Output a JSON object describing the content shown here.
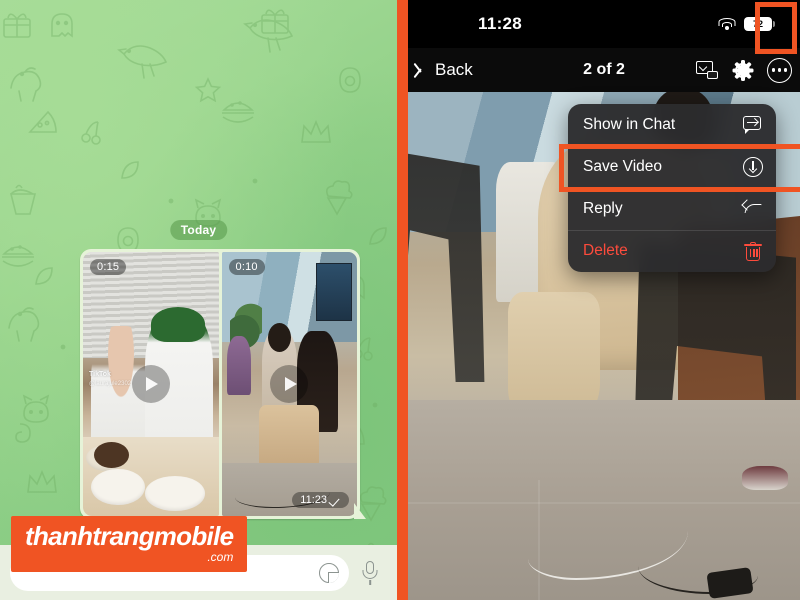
{
  "left_panel": {
    "date_chip": "Today",
    "message": {
      "timestamp": "11:23",
      "read_state_icon": "checkmark-icon",
      "videos": [
        {
          "duration": "0:15",
          "play_icon": "play-icon",
          "watermark_app": "TikTok",
          "watermark_user": "@laurajule2302"
        },
        {
          "duration": "0:10",
          "play_icon": "play-icon"
        }
      ]
    },
    "input_bar": {
      "placeholder": "",
      "value": "",
      "sticker_icon": "sticker-icon",
      "mic_icon": "microphone-icon"
    },
    "watermark": {
      "main": "thanhtrangmobile",
      "sub": ".com",
      "color": "#f05423"
    }
  },
  "right_panel": {
    "status_bar": {
      "time": "11:28",
      "wifi_icon": "wifi-icon",
      "battery_level": "72",
      "battery_icon": "battery-icon"
    },
    "nav_bar": {
      "back_label": "Back",
      "back_icon": "chevron-left-icon",
      "title": "2 of 2",
      "pip_icon": "picture-in-picture-icon",
      "settings_icon": "gear-icon",
      "more_icon": "more-dots-icon"
    },
    "context_menu": {
      "items": [
        {
          "label": "Show in Chat",
          "icon": "show-in-chat-icon",
          "destructive": false
        },
        {
          "label": "Save Video",
          "icon": "download-circle-icon",
          "destructive": false
        },
        {
          "label": "Reply",
          "icon": "reply-arrow-icon",
          "destructive": false
        },
        {
          "label": "Delete",
          "icon": "trash-icon",
          "destructive": true
        }
      ],
      "highlighted_item": "Save Video"
    }
  },
  "annotation": {
    "highlight_color": "#f05423",
    "divider_color": "#f05423"
  }
}
